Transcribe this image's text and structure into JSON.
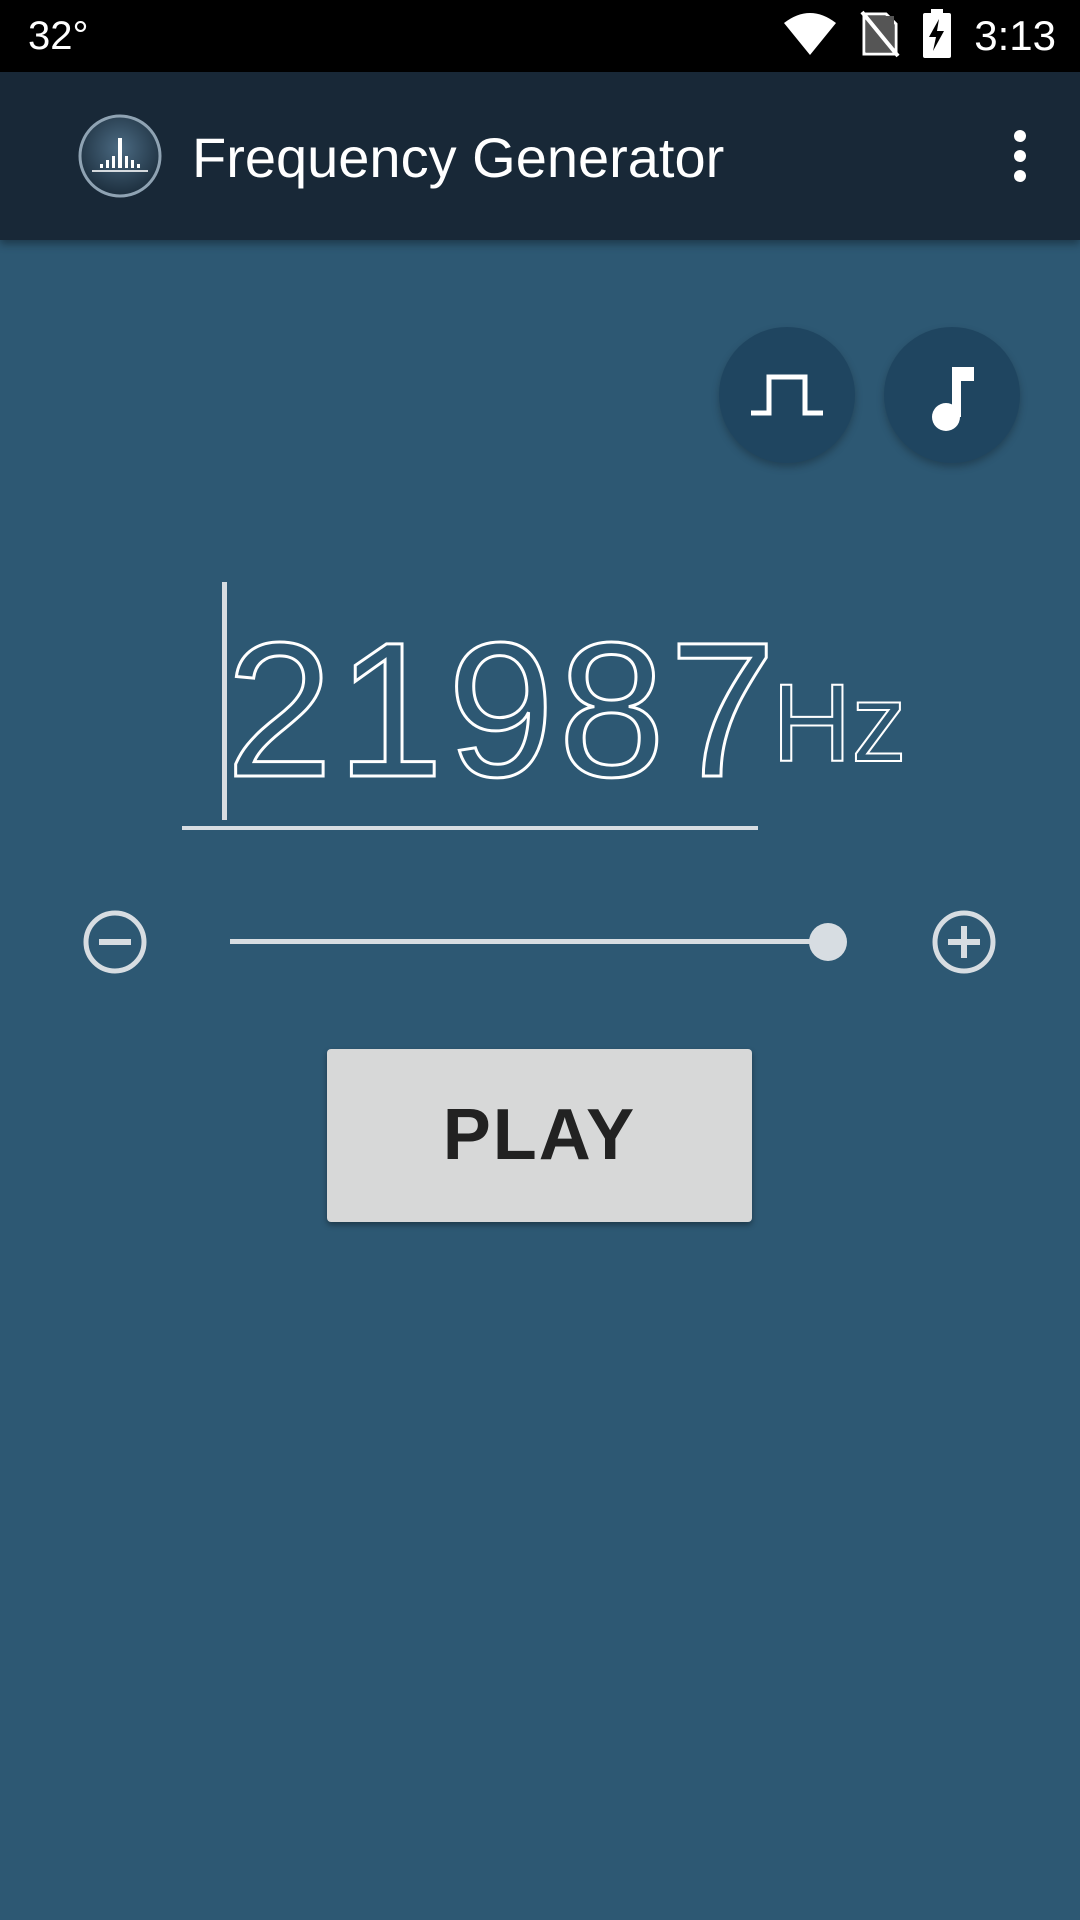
{
  "status_bar": {
    "temperature": "32°",
    "time": "3:13",
    "icons": [
      "wifi-icon",
      "no-sim-icon",
      "battery-charging-icon"
    ]
  },
  "app_bar": {
    "title": "Frequency Generator",
    "logo_icon": "spectrum-logo-icon",
    "menu_icon": "overflow-menu-icon"
  },
  "wave_controls": {
    "waveform_icon": "square-wave-icon",
    "note_icon": "music-note-icon"
  },
  "frequency": {
    "value": "21987",
    "unit": "Hz"
  },
  "slider": {
    "level": 0.97,
    "minus_icon": "minus-circle-icon",
    "plus_icon": "plus-circle-icon"
  },
  "play_button": {
    "label": "PLAY"
  },
  "colors": {
    "background": "#2d5873",
    "app_bar": "#182837",
    "status_bar": "#000000",
    "round_button": "#1f4560",
    "play_button": "#d7d8d8",
    "slider": "#d7dde2"
  }
}
